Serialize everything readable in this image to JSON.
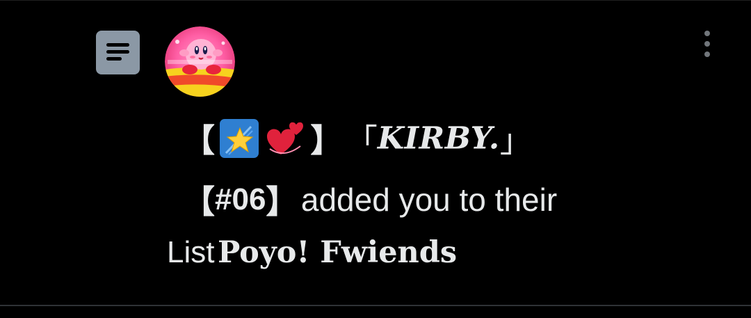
{
  "notification": {
    "type_icon": "list-icon",
    "avatar_icon": "kirby-avatar",
    "menu_icon": "more-vertical-icon",
    "user": {
      "open_bracket": "【",
      "emoji_1": "shooting-star-emoji",
      "emoji_2": "revolving-hearts-emoji",
      "close_bracket": "】",
      "name_open_quote": "「",
      "name": "KIRBY.",
      "name_close_quote": "」",
      "tag_open": "【",
      "tag": "#06",
      "tag_close": "】"
    },
    "action_text": "added you to their",
    "list_label": "List",
    "list_name": "Poyo! Fwiends"
  },
  "colors": {
    "background": "#000000",
    "text": "#e7e9ea",
    "icon_box": "#8b98a5",
    "muted": "#71767b"
  }
}
